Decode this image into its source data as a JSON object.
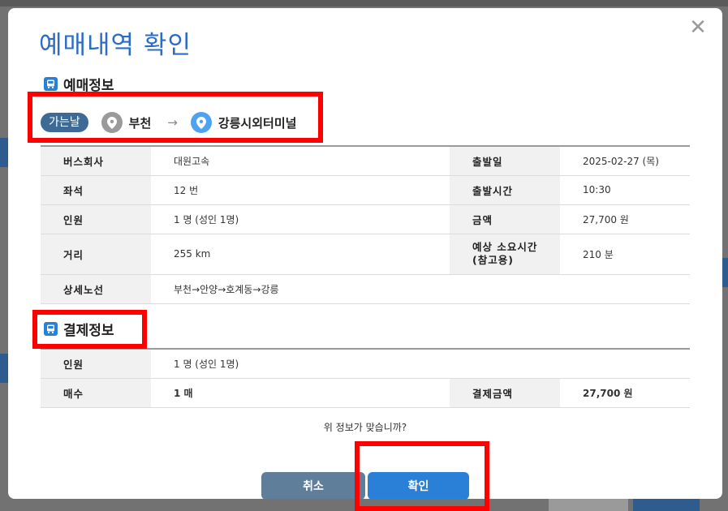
{
  "modal": {
    "title": "예매내역 확인",
    "close_icon": "close-icon",
    "question": "위 정보가 맞습니까?",
    "cancel_label": "취소",
    "confirm_label": "확인"
  },
  "reservation": {
    "section_title": "예매정보",
    "route": {
      "badge": "가는날",
      "origin": "부천",
      "destination": "강릉시외터미널"
    },
    "rows": [
      {
        "h1": "버스회사",
        "v1": "대원고속",
        "h2": "출발일",
        "v2": "2025-02-27 (목)"
      },
      {
        "h1": "좌석",
        "v1": "12 번",
        "h2": "출발시간",
        "v2": "10:30"
      },
      {
        "h1": "인원",
        "v1": "1 명 (성인 1명)",
        "h2": "금액",
        "v2": "27,700 원"
      },
      {
        "h1": "거리",
        "v1": "255 km",
        "h2": "예상 소요시간\n(참고용)",
        "v2": "210 분"
      }
    ],
    "route_detail_label": "상세노선",
    "route_detail": "부천→안양→호계동→강릉"
  },
  "payment": {
    "section_title": "결제정보",
    "people_label": "인원",
    "people_value": "1 명 (성인 1명)",
    "count_label": "매수",
    "count_value": "1 매",
    "amount_label": "결제금액",
    "amount_value": "27,700 원"
  },
  "colors": {
    "title": "#2c6cc4",
    "badge": "#3d6b95",
    "confirm_button": "#2a7fd6",
    "cancel_button": "#5f7e9a",
    "highlight": "#ff0000"
  }
}
